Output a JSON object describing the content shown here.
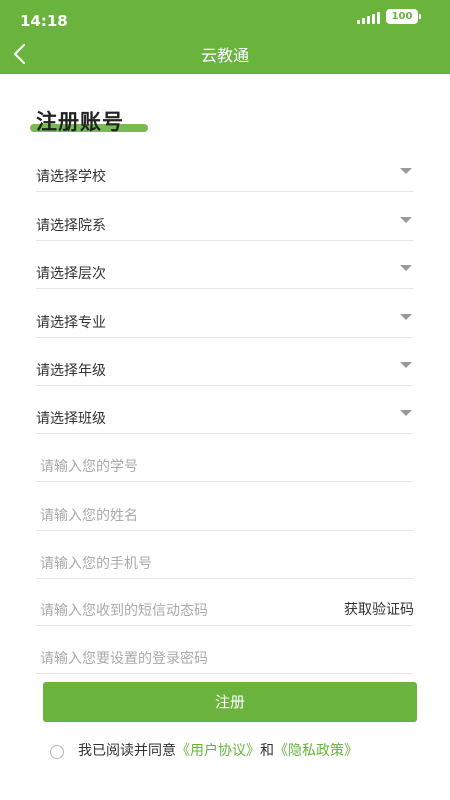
{
  "status_bar": {
    "time": "14:18",
    "battery": "100"
  },
  "header": {
    "title": "云教通"
  },
  "page": {
    "heading": "注册账号"
  },
  "selects": [
    {
      "label": "请选择学校"
    },
    {
      "label": "请选择院系"
    },
    {
      "label": "请选择层次"
    },
    {
      "label": "请选择专业"
    },
    {
      "label": "请选择年级"
    },
    {
      "label": "请选择班级"
    }
  ],
  "inputs": {
    "student_id": {
      "placeholder": "请输入您的学号"
    },
    "name": {
      "placeholder": "请输入您的姓名"
    },
    "phone": {
      "placeholder": "请输入您的手机号"
    },
    "sms_code": {
      "placeholder": "请输入您收到的短信动态码",
      "button": "获取验证码"
    },
    "password": {
      "placeholder": "请输入您要设置的登录密码"
    }
  },
  "submit": {
    "label": "注册"
  },
  "agreement": {
    "prefix": "我已阅读并同意",
    "user_agreement": "《用户协议》",
    "and": "和",
    "privacy_policy": "《隐私政策》"
  },
  "colors": {
    "brand": "#6ab43e"
  },
  "icons": {
    "back": "chevron-left-icon",
    "dropdown": "caret-down-icon"
  }
}
